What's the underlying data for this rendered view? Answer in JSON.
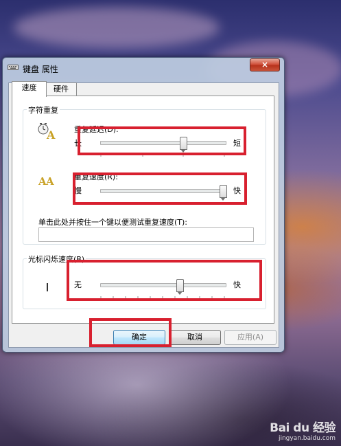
{
  "dialog": {
    "title": "键盘 属性",
    "close_label": "×",
    "tabs": [
      {
        "label": "速度",
        "active": true
      },
      {
        "label": "硬件",
        "active": false
      }
    ]
  },
  "character_repeat": {
    "group_label": "字符重复",
    "repeat_delay": {
      "label": "重复延迟(D):",
      "min_label": "长",
      "max_label": "短",
      "value_fraction": 0.67
    },
    "repeat_rate": {
      "label": "重复速度(R):",
      "min_label": "慢",
      "max_label": "快",
      "value_fraction": 1.0
    },
    "test_prompt": "单击此处并按住一个键以便测试重复速度(T):",
    "test_value": ""
  },
  "cursor_blink": {
    "group_label": "光标闪烁速度(B)",
    "min_label": "无",
    "max_label": "快",
    "value_fraction": 0.62
  },
  "buttons": {
    "ok": "确定",
    "cancel": "取消",
    "apply": "应用(A)"
  },
  "watermark": {
    "logo": "Bai du 经验",
    "url": "jingyan.baidu.com"
  },
  "colors": {
    "annotation_red": "#d8202f",
    "dialog_frame": "#bfcde0"
  }
}
